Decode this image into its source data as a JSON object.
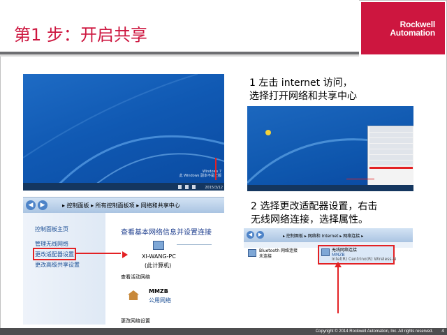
{
  "slide": {
    "title": "第1 步：开启共享",
    "logo_line1": "Rockwell",
    "logo_line2": "Automation",
    "footer": "Copyright © 2014 Rockwell Automation, Inc. All rights reserved.",
    "page_number": "4"
  },
  "captions": {
    "step1_line1": "1 左击 internet 访问，",
    "step1_line2": "选择打开网络和共享中心",
    "step2_line1": "2 选择更改适配器设置，右击",
    "step2_line2": "无线网络连接，选择属性。"
  },
  "desktop": {
    "watermark_line1": "Windows 7",
    "watermark_line2": "此 Windows 副本不是正版",
    "clock": "2015/3/12"
  },
  "control_panel": {
    "breadcrumb": "▸ 控制面板 ▸ 所有控制面板项 ▸ 网络和共享中心",
    "left_items": [
      "控制面板主页",
      "管理无线网络",
      "更改适配器设置",
      "更改高级共享设置"
    ],
    "heading": "查看基本网络信息并设置连接",
    "pc_name": "XI-WANG-PC",
    "pc_sub": "(此计算机)",
    "section_active": "查看活动网络",
    "network_name": "MMZB",
    "network_type": "公用网络",
    "section_change": "更改网络设置"
  },
  "adapter": {
    "breadcrumb": "▸ 控制面板 ▸ 网络和 Internet ▸ 网络连接 ▸",
    "item1_name": "Bluetooth 网络连接",
    "item1_status": "未连接",
    "item2_name": "无线网络连接",
    "item2_status": "MMZB",
    "item2_device": "Intel(R) Centrino(R) Wireless-N"
  },
  "colors": {
    "accent_red": "#cd163f",
    "highlight_red": "#e32124",
    "footer_gray": "#4d4d4f"
  }
}
